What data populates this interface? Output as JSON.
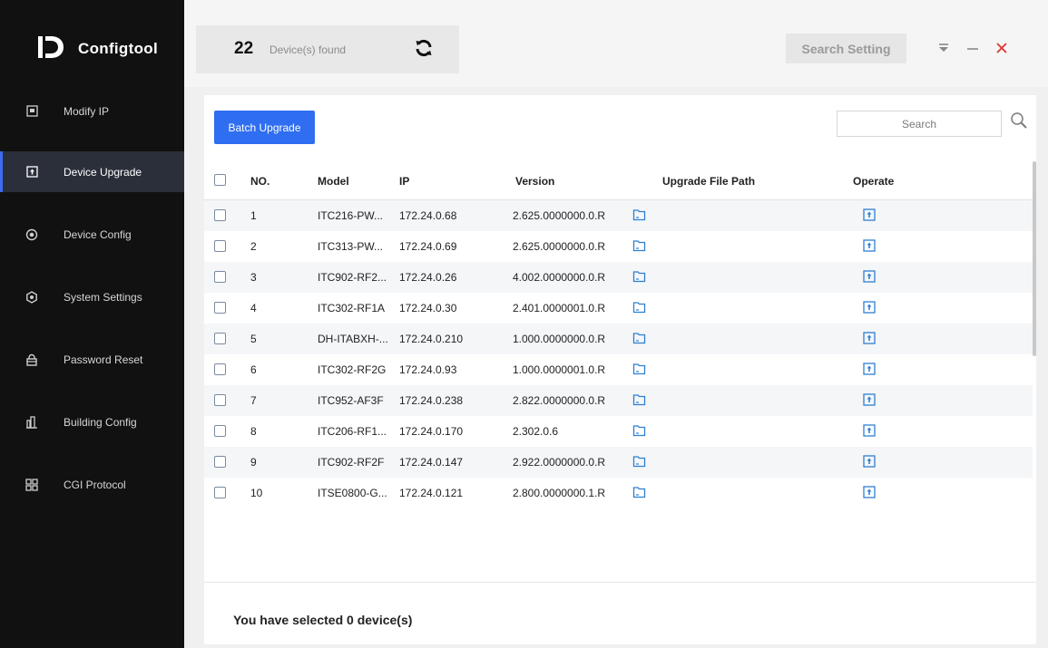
{
  "app": {
    "name": "Configtool"
  },
  "sidebar": {
    "items": [
      {
        "label": "Modify IP",
        "icon": "ip-icon",
        "active": false
      },
      {
        "label": "Device Upgrade",
        "icon": "upgrade-icon",
        "active": true
      },
      {
        "label": "Device Config",
        "icon": "target-icon",
        "active": false
      },
      {
        "label": "System Settings",
        "icon": "settings-hex-icon",
        "active": false
      },
      {
        "label": "Password Reset",
        "icon": "lock-icon",
        "active": false
      },
      {
        "label": "Building Config",
        "icon": "building-icon",
        "active": false
      },
      {
        "label": "CGI Protocol",
        "icon": "grid-icon",
        "active": false
      }
    ]
  },
  "topbar": {
    "count": "22",
    "count_label": "Device(s) found",
    "search_setting": "Search Setting"
  },
  "toolbar": {
    "batch_upgrade": "Batch Upgrade",
    "search_placeholder": "Search"
  },
  "table": {
    "headers": {
      "no": "NO.",
      "model": "Model",
      "ip": "IP",
      "version": "Version",
      "path": "Upgrade File Path",
      "operate": "Operate"
    },
    "rows": [
      {
        "no": "1",
        "model": "ITC216-PW...",
        "ip": "172.24.0.68",
        "version": "2.625.0000000.0.R"
      },
      {
        "no": "2",
        "model": "ITC313-PW...",
        "ip": "172.24.0.69",
        "version": "2.625.0000000.0.R"
      },
      {
        "no": "3",
        "model": "ITC902-RF2...",
        "ip": "172.24.0.26",
        "version": "4.002.0000000.0.R"
      },
      {
        "no": "4",
        "model": "ITC302-RF1A",
        "ip": "172.24.0.30",
        "version": "2.401.0000001.0.R"
      },
      {
        "no": "5",
        "model": "DH-ITABXH-...",
        "ip": "172.24.0.210",
        "version": "1.000.0000000.0.R"
      },
      {
        "no": "6",
        "model": "ITC302-RF2G",
        "ip": "172.24.0.93",
        "version": "1.000.0000001.0.R"
      },
      {
        "no": "7",
        "model": "ITC952-AF3F",
        "ip": "172.24.0.238",
        "version": "2.822.0000000.0.R"
      },
      {
        "no": "8",
        "model": "ITC206-RF1...",
        "ip": "172.24.0.170",
        "version": "2.302.0.6"
      },
      {
        "no": "9",
        "model": "ITC902-RF2F",
        "ip": "172.24.0.147",
        "version": "2.922.0000000.0.R"
      },
      {
        "no": "10",
        "model": "ITSE0800-G...",
        "ip": "172.24.0.121",
        "version": "2.800.0000000.1.R"
      }
    ]
  },
  "footer": {
    "selected_text": "You have selected 0  device(s)"
  },
  "colors": {
    "accent": "#2f6ef0",
    "sidebar_bg": "#111111",
    "close": "#e0322e"
  }
}
